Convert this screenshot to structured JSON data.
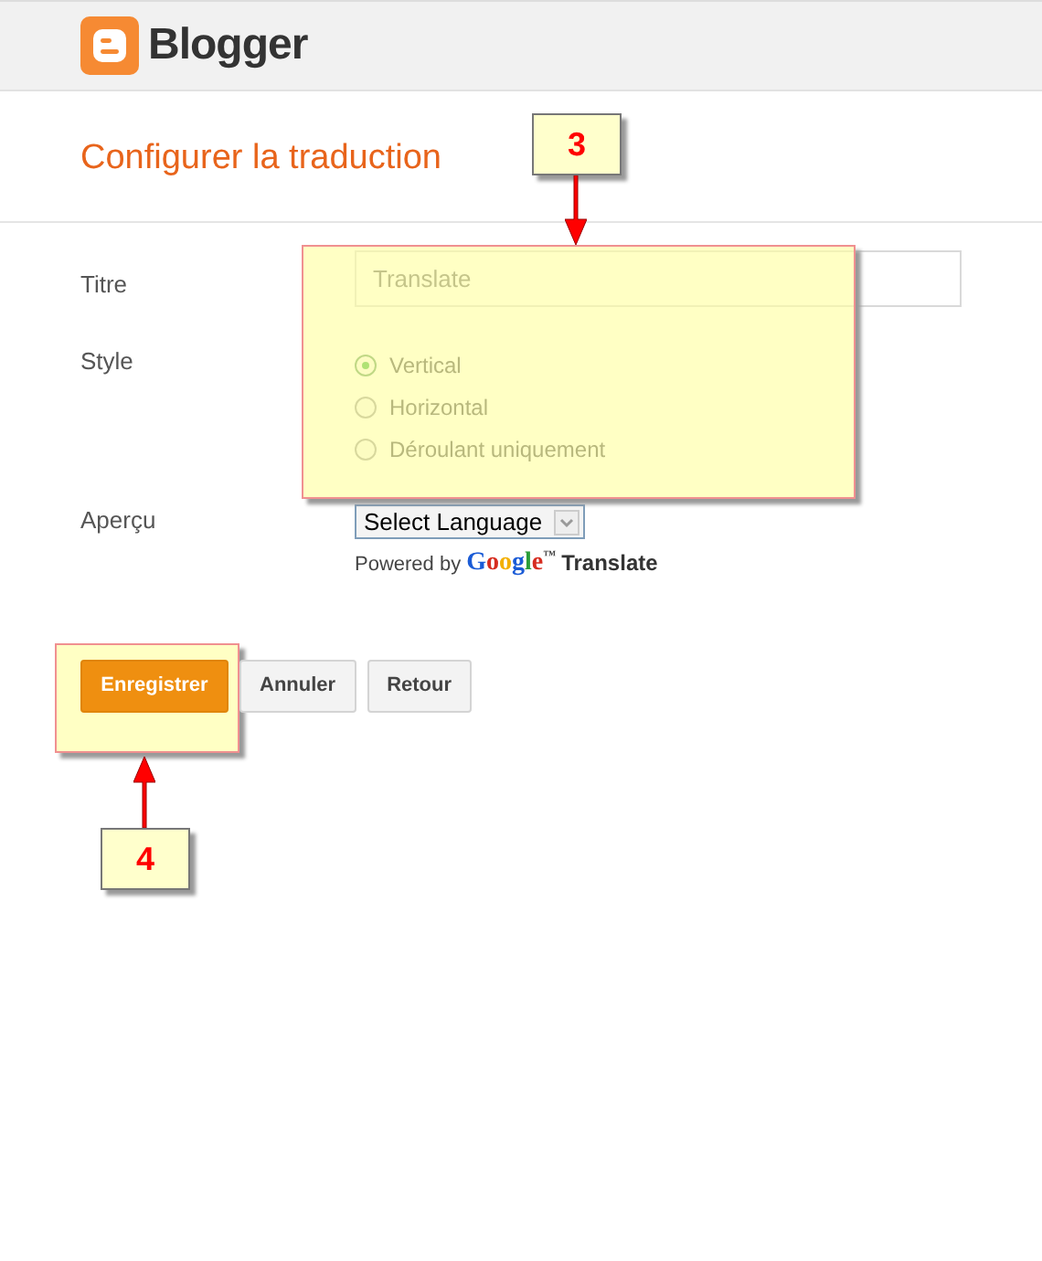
{
  "header": {
    "brand": "Blogger"
  },
  "page_title": "Configurer la traduction",
  "form": {
    "title_label": "Titre",
    "title_value": "Translate",
    "style_label": "Style",
    "styles": [
      {
        "label": "Vertical",
        "selected": true
      },
      {
        "label": "Horizontal",
        "selected": false
      },
      {
        "label": "Déroulant uniquement",
        "selected": false
      }
    ],
    "preview_label": "Aperçu",
    "select_value": "Select Language",
    "powered_by": {
      "prefix": "Powered by",
      "logo": "Google",
      "tm": "™",
      "suffix": "Translate"
    }
  },
  "buttons": [
    {
      "label": "Enregistrer",
      "kind": "primary"
    },
    {
      "label": "Annuler",
      "kind": "secondary"
    },
    {
      "label": "Retour",
      "kind": "secondary"
    }
  ],
  "callouts": [
    {
      "number": "3",
      "kind": "down"
    },
    {
      "number": "4",
      "kind": "up"
    }
  ]
}
